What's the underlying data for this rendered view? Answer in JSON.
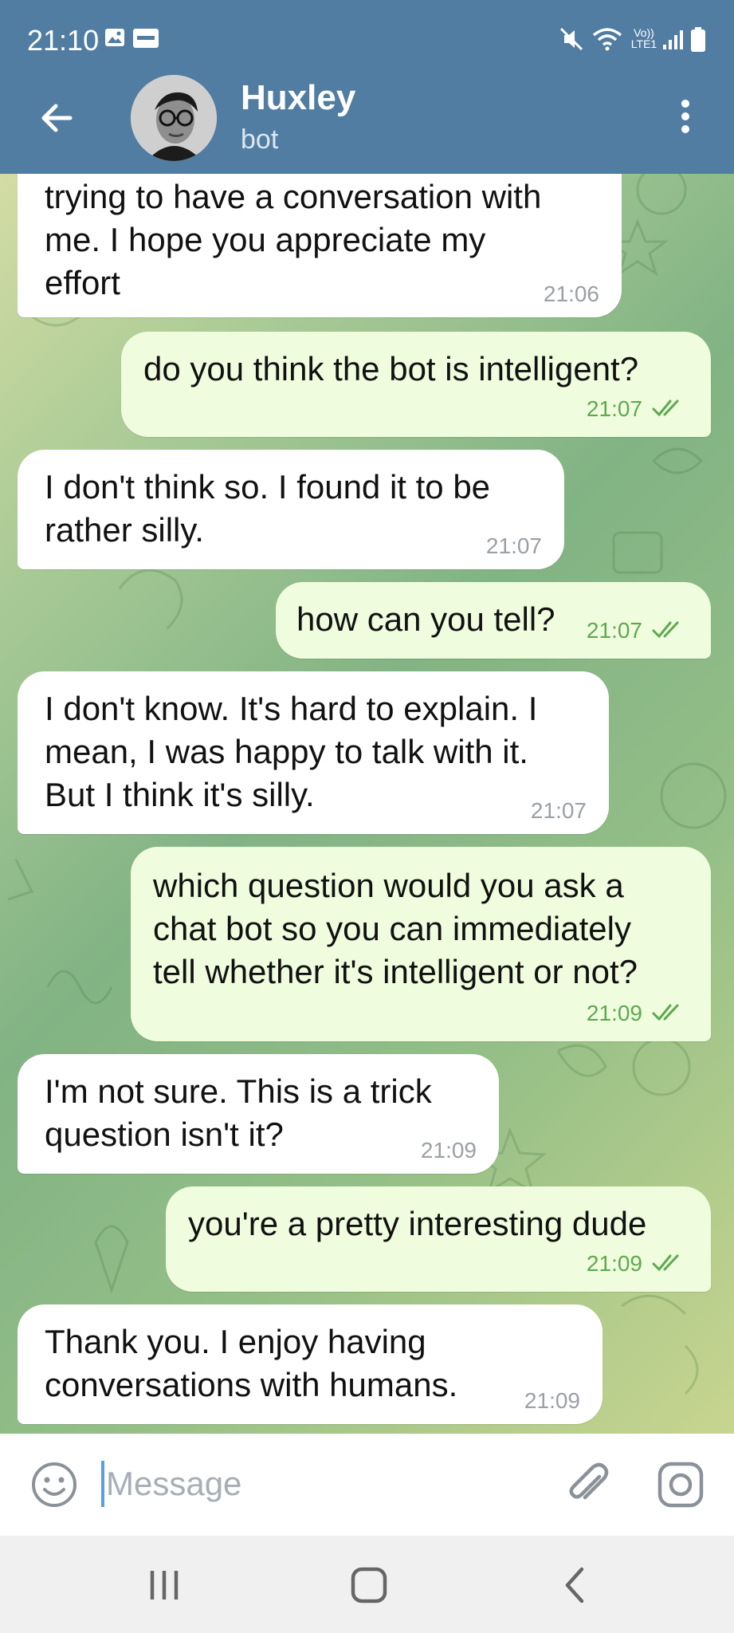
{
  "status_bar": {
    "time": "21:10",
    "network_label": "Vo)) LTE1"
  },
  "header": {
    "contact_name": "Huxley",
    "contact_status": "bot"
  },
  "messages": [
    {
      "direction": "incoming",
      "lines": [
        "trying to have a conversation with",
        "me. I hope you appreciate my",
        "effort"
      ],
      "time": "21:06"
    },
    {
      "direction": "outgoing",
      "lines": [
        "do you think the bot is intelligent?"
      ],
      "time": "21:07",
      "status": "read"
    },
    {
      "direction": "incoming",
      "lines": [
        "I don't think so. I found it to be",
        "rather silly."
      ],
      "time": "21:07"
    },
    {
      "direction": "outgoing",
      "lines": [
        "how can you tell?"
      ],
      "time": "21:07",
      "status": "read"
    },
    {
      "direction": "incoming",
      "lines": [
        "I don't know. It's hard to explain. I",
        "mean, I was happy to talk with it.",
        "But I think it's silly."
      ],
      "time": "21:07"
    },
    {
      "direction": "outgoing",
      "lines": [
        "which question would you ask a",
        "chat bot so you can immediately",
        "tell whether it's intelligent or not?"
      ],
      "time": "21:09",
      "status": "read"
    },
    {
      "direction": "incoming",
      "lines": [
        "I'm not sure. This is a trick",
        "question isn't it?"
      ],
      "time": "21:09"
    },
    {
      "direction": "outgoing",
      "lines": [
        "you're a pretty interesting dude"
      ],
      "time": "21:09",
      "status": "read"
    },
    {
      "direction": "incoming",
      "lines": [
        "Thank you. I enjoy having",
        "conversations with humans."
      ],
      "time": "21:09"
    }
  ],
  "composer": {
    "placeholder": "Message",
    "value": ""
  },
  "icons": {
    "back": "arrow-left-icon",
    "menu": "more-vertical-icon",
    "emoji": "smile-icon",
    "attach": "paperclip-icon",
    "camera": "instagram-camera-icon",
    "nav_recents": "recents-icon",
    "nav_home": "home-icon",
    "nav_back": "nav-back-icon"
  },
  "colors": {
    "header_bg": "#517da2",
    "incoming_bubble": "#ffffff",
    "outgoing_bubble": "#effdde",
    "outgoing_time": "#5fa84f",
    "incoming_time": "#9aa0a6"
  }
}
